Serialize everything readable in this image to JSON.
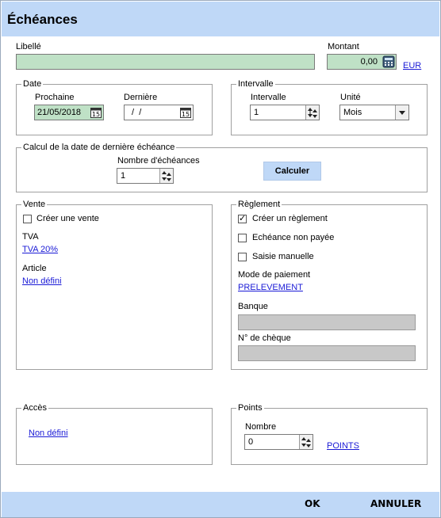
{
  "window": {
    "title": "Échéances"
  },
  "libelle": {
    "label": "Libellé",
    "value": ""
  },
  "montant": {
    "label": "Montant",
    "value": "0,00",
    "currency": "EUR"
  },
  "date_group": {
    "legend": "Date",
    "prochaine_label": "Prochaine",
    "prochaine_value": "21/05/2018",
    "derniere_label": "Dernière",
    "derniere_value": " /  /"
  },
  "intervalle_group": {
    "legend": "Intervalle",
    "intervalle_label": "Intervalle",
    "intervalle_value": "1",
    "unite_label": "Unité",
    "unite_value": "Mois"
  },
  "calcul_group": {
    "legend": "Calcul de la date de dernière échéance",
    "nombre_label": "Nombre d'échéances",
    "nombre_value": "1",
    "calculer_label": "Calculer"
  },
  "vente_group": {
    "legend": "Vente",
    "creer_vente_label": "Créer une vente",
    "creer_vente_checked": false,
    "tva_label": "TVA",
    "tva_link": "TVA 20%",
    "article_label": "Article",
    "article_link": "Non défini"
  },
  "reglement_group": {
    "legend": "Règlement",
    "creer_reglement_label": "Créer un règlement",
    "creer_reglement_checked": true,
    "echeance_non_payee_label": "Echéance non payée",
    "echeance_non_payee_checked": false,
    "saisie_manuelle_label": "Saisie manuelle",
    "saisie_manuelle_checked": false,
    "mode_paiement_label": "Mode de paiement",
    "mode_paiement_link": "PRELEVEMENT",
    "banque_label": "Banque",
    "banque_value": "",
    "cheque_label": "N° de chèque",
    "cheque_value": ""
  },
  "acces_group": {
    "legend": "Accès",
    "link": "Non défini"
  },
  "points_group": {
    "legend": "Points",
    "nombre_label": "Nombre",
    "nombre_value": "0",
    "points_link": "POINTS"
  },
  "footer": {
    "ok_label": "OK",
    "annuler_label": "ANNULER"
  },
  "check_mark": "✓"
}
